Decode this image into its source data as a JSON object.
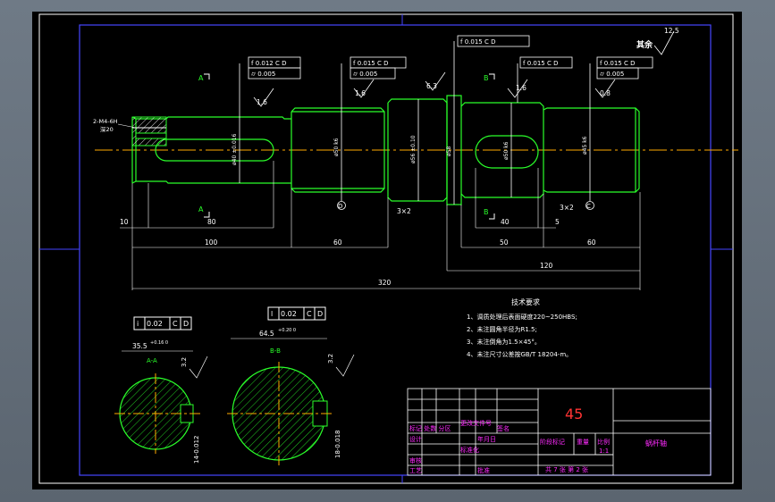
{
  "title_block": {
    "material": "45",
    "part_name": "蜗杆轴",
    "scale_label": "比例",
    "scale": "1:1",
    "weight_label": "重量",
    "stage_label": "阶段标记",
    "sheets": "共 7 张  第 2 张",
    "cells": {
      "designer": "设计",
      "checker": "审核",
      "process": "工艺",
      "standard": "标准化",
      "approve": "批准",
      "mark_area": "标记 处数 分区",
      "change_doc": "更改文件号",
      "signature": "签名",
      "date": "年月日"
    }
  },
  "roughness_other": {
    "label": "其余",
    "value": "12.5"
  },
  "roughness": [
    "1.6",
    "1.6",
    "6.3",
    "1.6",
    "0.8",
    "3.2",
    "3.2"
  ],
  "tolerance_frames": [
    [
      "f",
      "0.012",
      "C",
      "D"
    ],
    [
      "f",
      "0.015",
      "C",
      "D"
    ],
    [
      "f",
      "0.015",
      "C",
      "D"
    ],
    [
      "f",
      "0.015",
      "C",
      "D"
    ],
    [
      "f",
      "0.015",
      "C",
      "D"
    ],
    [
      "i",
      "0.02",
      "C",
      "D"
    ],
    [
      "l",
      "0.02",
      "C",
      "D"
    ]
  ],
  "cylindricity_frames": [
    "0.005",
    "0.005",
    "0.005"
  ],
  "diameters": [
    "ø40 ±0.016",
    "ø50 k6",
    "ø56 ±0.10",
    "ø58",
    "ø50 k6",
    "ø45 k6"
  ],
  "datums": [
    "D",
    "C"
  ],
  "thread_note": [
    "2-M4-6H",
    "深20"
  ],
  "section_labels": {
    "a_top": "A",
    "a_bot": "A",
    "b_top": "B",
    "b_bot": "B",
    "aa": "A-A",
    "bb": "B-B"
  },
  "section_dims": {
    "aa_width": "35.5",
    "aa_tol": "+0.16 0",
    "aa_key": "14-0.012",
    "bb_width": "64.5",
    "bb_tol": "+0.20 0",
    "bb_key": "18-0.018"
  },
  "dimensions": [
    "10",
    "80",
    "100",
    "60",
    "3×2",
    "40",
    "3×2",
    "50",
    "5",
    "60",
    "120",
    "320"
  ],
  "tech_notes": {
    "title": "技术要求",
    "lines": [
      "1、调质处理后表面硬度220~250HBS;",
      "2、未注圆角半径为R1.5;",
      "3、未注倒角为1.5×45°。",
      "4、未注尺寸公差按GB/T 18204-m。"
    ]
  }
}
